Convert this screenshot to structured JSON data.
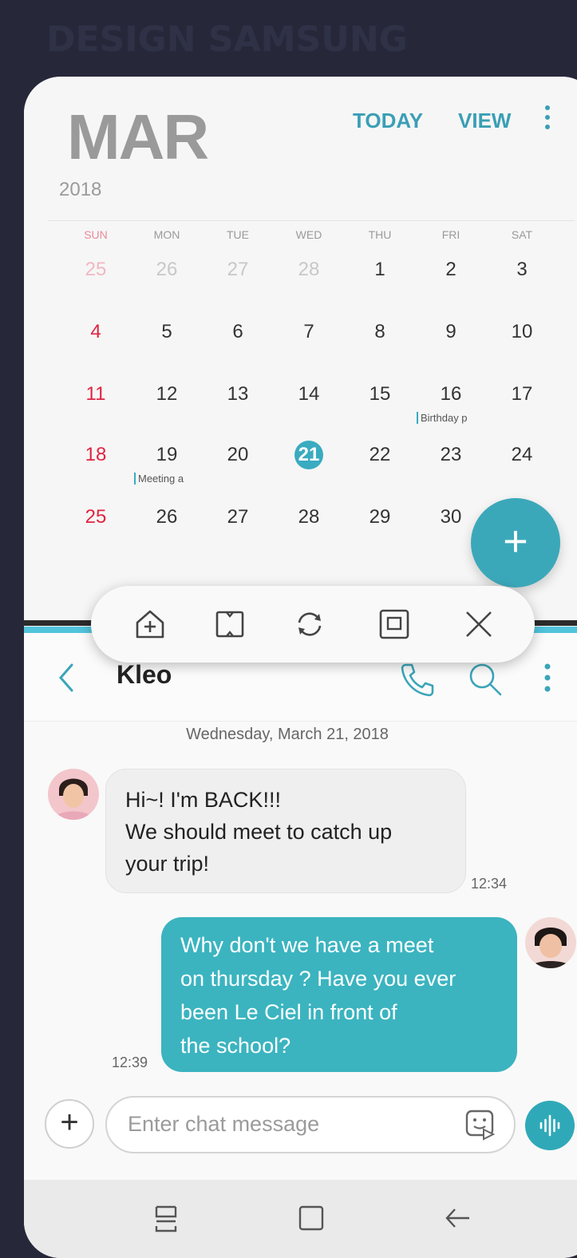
{
  "brand": "DESIGN SAMSUNG",
  "calendar": {
    "month": "MAR",
    "year": "2018",
    "today_label": "TODAY",
    "view_label": "VIEW",
    "weekdays": [
      "SUN",
      "MON",
      "TUE",
      "WED",
      "THU",
      "FRI",
      "SAT"
    ],
    "weeks": [
      [
        "25",
        "26",
        "27",
        "28",
        "1",
        "2",
        "3"
      ],
      [
        "4",
        "5",
        "6",
        "7",
        "8",
        "9",
        "10"
      ],
      [
        "11",
        "12",
        "13",
        "14",
        "15",
        "16",
        "17"
      ],
      [
        "18",
        "19",
        "20",
        "21",
        "22",
        "23",
        "24"
      ],
      [
        "25",
        "26",
        "27",
        "28",
        "29",
        "30",
        ""
      ]
    ],
    "selected_day": "21",
    "events": {
      "birthday": "Birthday p",
      "meeting": "Meeting a"
    },
    "accent": "#3aabc0"
  },
  "chat": {
    "contact": "Kleo",
    "date": "Wednesday, March 21, 2018",
    "incoming": {
      "lines": [
        "Hi~! I'm BACK!!!",
        "We should meet to catch up",
        "your trip!"
      ],
      "time": "12:34"
    },
    "outgoing": {
      "lines": [
        "Why don't we have a meet",
        "on thursday ? Have you ever",
        "been Le Ciel in front of",
        "the school?"
      ],
      "time": "12:39"
    },
    "input_placeholder": "Enter chat message"
  },
  "icons": {
    "toolbar": [
      "add-to-home-icon",
      "resize-window-icon",
      "swap-windows-icon",
      "pop-up-view-icon",
      "close-icon"
    ],
    "header": [
      "back-icon",
      "phone-icon",
      "search-icon",
      "more-icon"
    ],
    "navbar": [
      "recents-icon",
      "home-icon",
      "back-icon"
    ]
  }
}
